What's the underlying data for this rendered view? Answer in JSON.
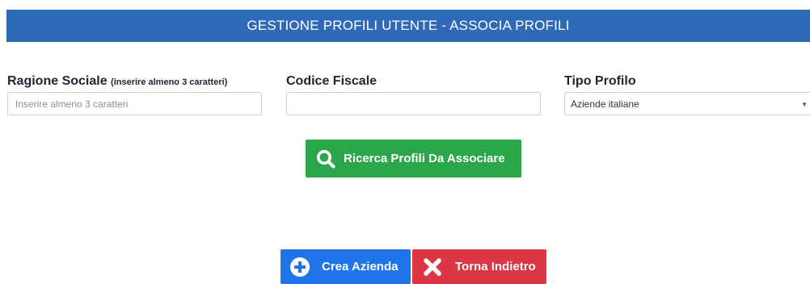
{
  "header": {
    "title": "GESTIONE PROFILI UTENTE - ASSOCIA PROFILI"
  },
  "form": {
    "ragione_sociale": {
      "label": "Ragione Sociale",
      "hint": "(inserire almeno 3 caratteri)",
      "placeholder": "Inserire almeno 3 caratteri",
      "value": ""
    },
    "codice_fiscale": {
      "label": "Codice Fiscale",
      "placeholder": "",
      "value": ""
    },
    "tipo_profilo": {
      "label": "Tipo Profilo",
      "selected": "Aziende italiane"
    }
  },
  "actions": {
    "search_label": "Ricerca Profili Da Associare",
    "create_label": "Crea Azienda",
    "back_label": "Torna Indietro"
  },
  "icons": {
    "search": "search-icon",
    "create": "plus-circle-icon",
    "back": "close-icon"
  },
  "colors": {
    "header_bg": "#2e6ab8",
    "search_btn": "#2ba64a",
    "create_btn": "#1e74e8",
    "back_btn": "#dc3545"
  }
}
